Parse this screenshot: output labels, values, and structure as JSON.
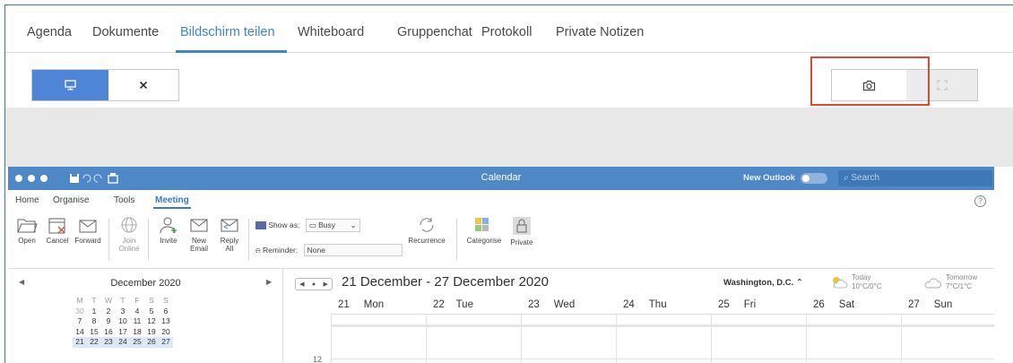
{
  "tabs": [
    {
      "label": "Agenda",
      "active": false
    },
    {
      "label": "Dokumente",
      "active": false
    },
    {
      "label": "Bildschirm teilen",
      "active": true
    },
    {
      "label": "Whiteboard",
      "active": false
    },
    {
      "label": "Gruppenchat",
      "active": false
    },
    {
      "label": "Protokoll",
      "active": false
    },
    {
      "label": "Private Notizen",
      "active": false
    }
  ],
  "toolbar": {
    "share_icon": "monitor-icon",
    "stop_icon": "close-icon",
    "snapshot_icon": "camera-icon",
    "fullscreen_icon": "fullscreen-icon",
    "accent_color": "#4f85d6",
    "highlight_color": "#e0492f"
  },
  "outlook": {
    "window_title": "Calendar",
    "new_outlook_label": "New Outlook",
    "search_placeholder": "Search",
    "ribbon_tabs": [
      "Home",
      "Organise",
      "Tools",
      "Meeting"
    ],
    "ribbon_active": "Meeting",
    "ribbon_buttons": {
      "open": "Open",
      "cancel": "Cancel",
      "forward": "Forward",
      "join_online_1": "Join",
      "join_online_2": "Online",
      "invite": "Invite",
      "new_email_1": "New",
      "new_email_2": "Email",
      "reply_all_1": "Reply",
      "reply_all_2": "All",
      "show_as_label": "Show as:",
      "show_as_value": "Busy",
      "reminder_label": "Reminder:",
      "reminder_value": "None",
      "recurrence": "Recurrence",
      "categorise": "Categorise",
      "private": "Private"
    },
    "mini_calendar": {
      "month": "December 2020",
      "weekday_headers": [
        "M",
        "T",
        "W",
        "T",
        "F",
        "S",
        "S"
      ],
      "weeks": [
        [
          "30",
          "1",
          "2",
          "3",
          "4",
          "5",
          "6"
        ],
        [
          "7",
          "8",
          "9",
          "10",
          "11",
          "12",
          "13"
        ],
        [
          "14",
          "15",
          "16",
          "17",
          "18",
          "19",
          "20"
        ],
        [
          "21",
          "22",
          "23",
          "24",
          "25",
          "26",
          "27"
        ]
      ],
      "selected_week_index": 3
    },
    "week_view": {
      "range": "21 December - 27 December 2020",
      "location": "Washington, D.C.",
      "weather": [
        {
          "label": "Today",
          "temp": "10°C/0°C"
        },
        {
          "label": "Tomorrow",
          "temp": "7°C/1°C"
        }
      ],
      "days": [
        {
          "num": "21",
          "name": "Mon"
        },
        {
          "num": "22",
          "name": "Tue"
        },
        {
          "num": "23",
          "name": "Wed"
        },
        {
          "num": "24",
          "name": "Thu"
        },
        {
          "num": "25",
          "name": "Fri"
        },
        {
          "num": "26",
          "name": "Sat"
        },
        {
          "num": "27",
          "name": "Sun"
        }
      ],
      "hour_label": "12"
    }
  }
}
